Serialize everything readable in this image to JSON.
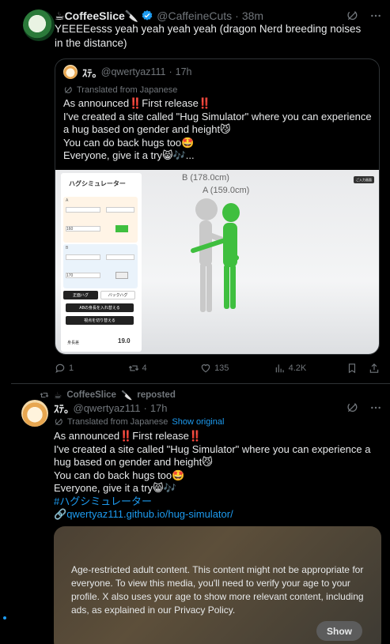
{
  "tweet": {
    "author": {
      "display_name": "CoffeeSlice",
      "name_emoji": "☕",
      "name_suffix": "🔪",
      "handle": "@CaffeineCuts",
      "verified": true,
      "avatar": "dragon-avatar"
    },
    "time": "38m",
    "text": "YEEEEesss yeah yeah yeah yeah (dragon Nerd breeding noises in the distance)",
    "quoted": {
      "author": {
        "display_name": "ｽﾃ｡",
        "handle": "@qwertyaz111",
        "avatar": "hamster-avatar"
      },
      "time": "17h",
      "translated_label": "Translated from Japanese",
      "lines": [
        "As announced‼️First release‼️",
        "I've created a site called \"Hug Simulator\" where you can experience a hug based on gender and height😼",
        "You can do back hugs too🤩",
        "Everyone, give it a try😸🎶..."
      ],
      "media": {
        "app_title": "ハグシミュレーター",
        "section_a": "A",
        "section_b": "B",
        "a_height": "160",
        "b_height": "170",
        "btn_front": "正面ハグ",
        "btn_back": "バックハグ",
        "btn_swap": "ABの身長を入れ替える",
        "btn_view": "視点を切り替える",
        "total_label": "身長差",
        "total_value": "19.0",
        "label_b": "B (178.0cm)",
        "label_a": "A (159.0cm)",
        "top_button": "ご入力画面"
      }
    },
    "actions": {
      "replies": "1",
      "reposts": "4",
      "likes": "135",
      "views": "4.2K"
    }
  },
  "repost": {
    "reposter_line": "CoffeeSlice",
    "reposter_emoji_pre": "☕",
    "reposter_emoji_post": "🔪",
    "reposted_label": "reposted",
    "author": {
      "display_name": "ｽﾃ｡",
      "handle": "@qwertyaz111",
      "avatar": "hamster-avatar"
    },
    "time": "17h",
    "translated_label": "Translated from Japanese",
    "show_original": "Show original",
    "lines": [
      "As announced‼️First release‼️",
      "I've created a site called \"Hug Simulator\" where you can experience a hug based on gender and height😼",
      "You can do back hugs too🤩",
      "Everyone, give it a try😸🎶"
    ],
    "hashtag": "#ハグシミュレーター",
    "link": "qwertyaz111.github.io/hug-simulator/",
    "age_notice": "Age-restricted adult content. This content might not be appropriate for everyone. To view this media, you'll need to verify your age to your profile. X also uses your age to show more relevant content, including ads, as explained in our Privacy Policy.",
    "show_button": "Show"
  },
  "colors": {
    "accent": "#1d9bf0",
    "muted": "#71767b",
    "border": "#2f3336",
    "figure_b": "#cccccc",
    "figure_a": "#3fbf3f"
  }
}
